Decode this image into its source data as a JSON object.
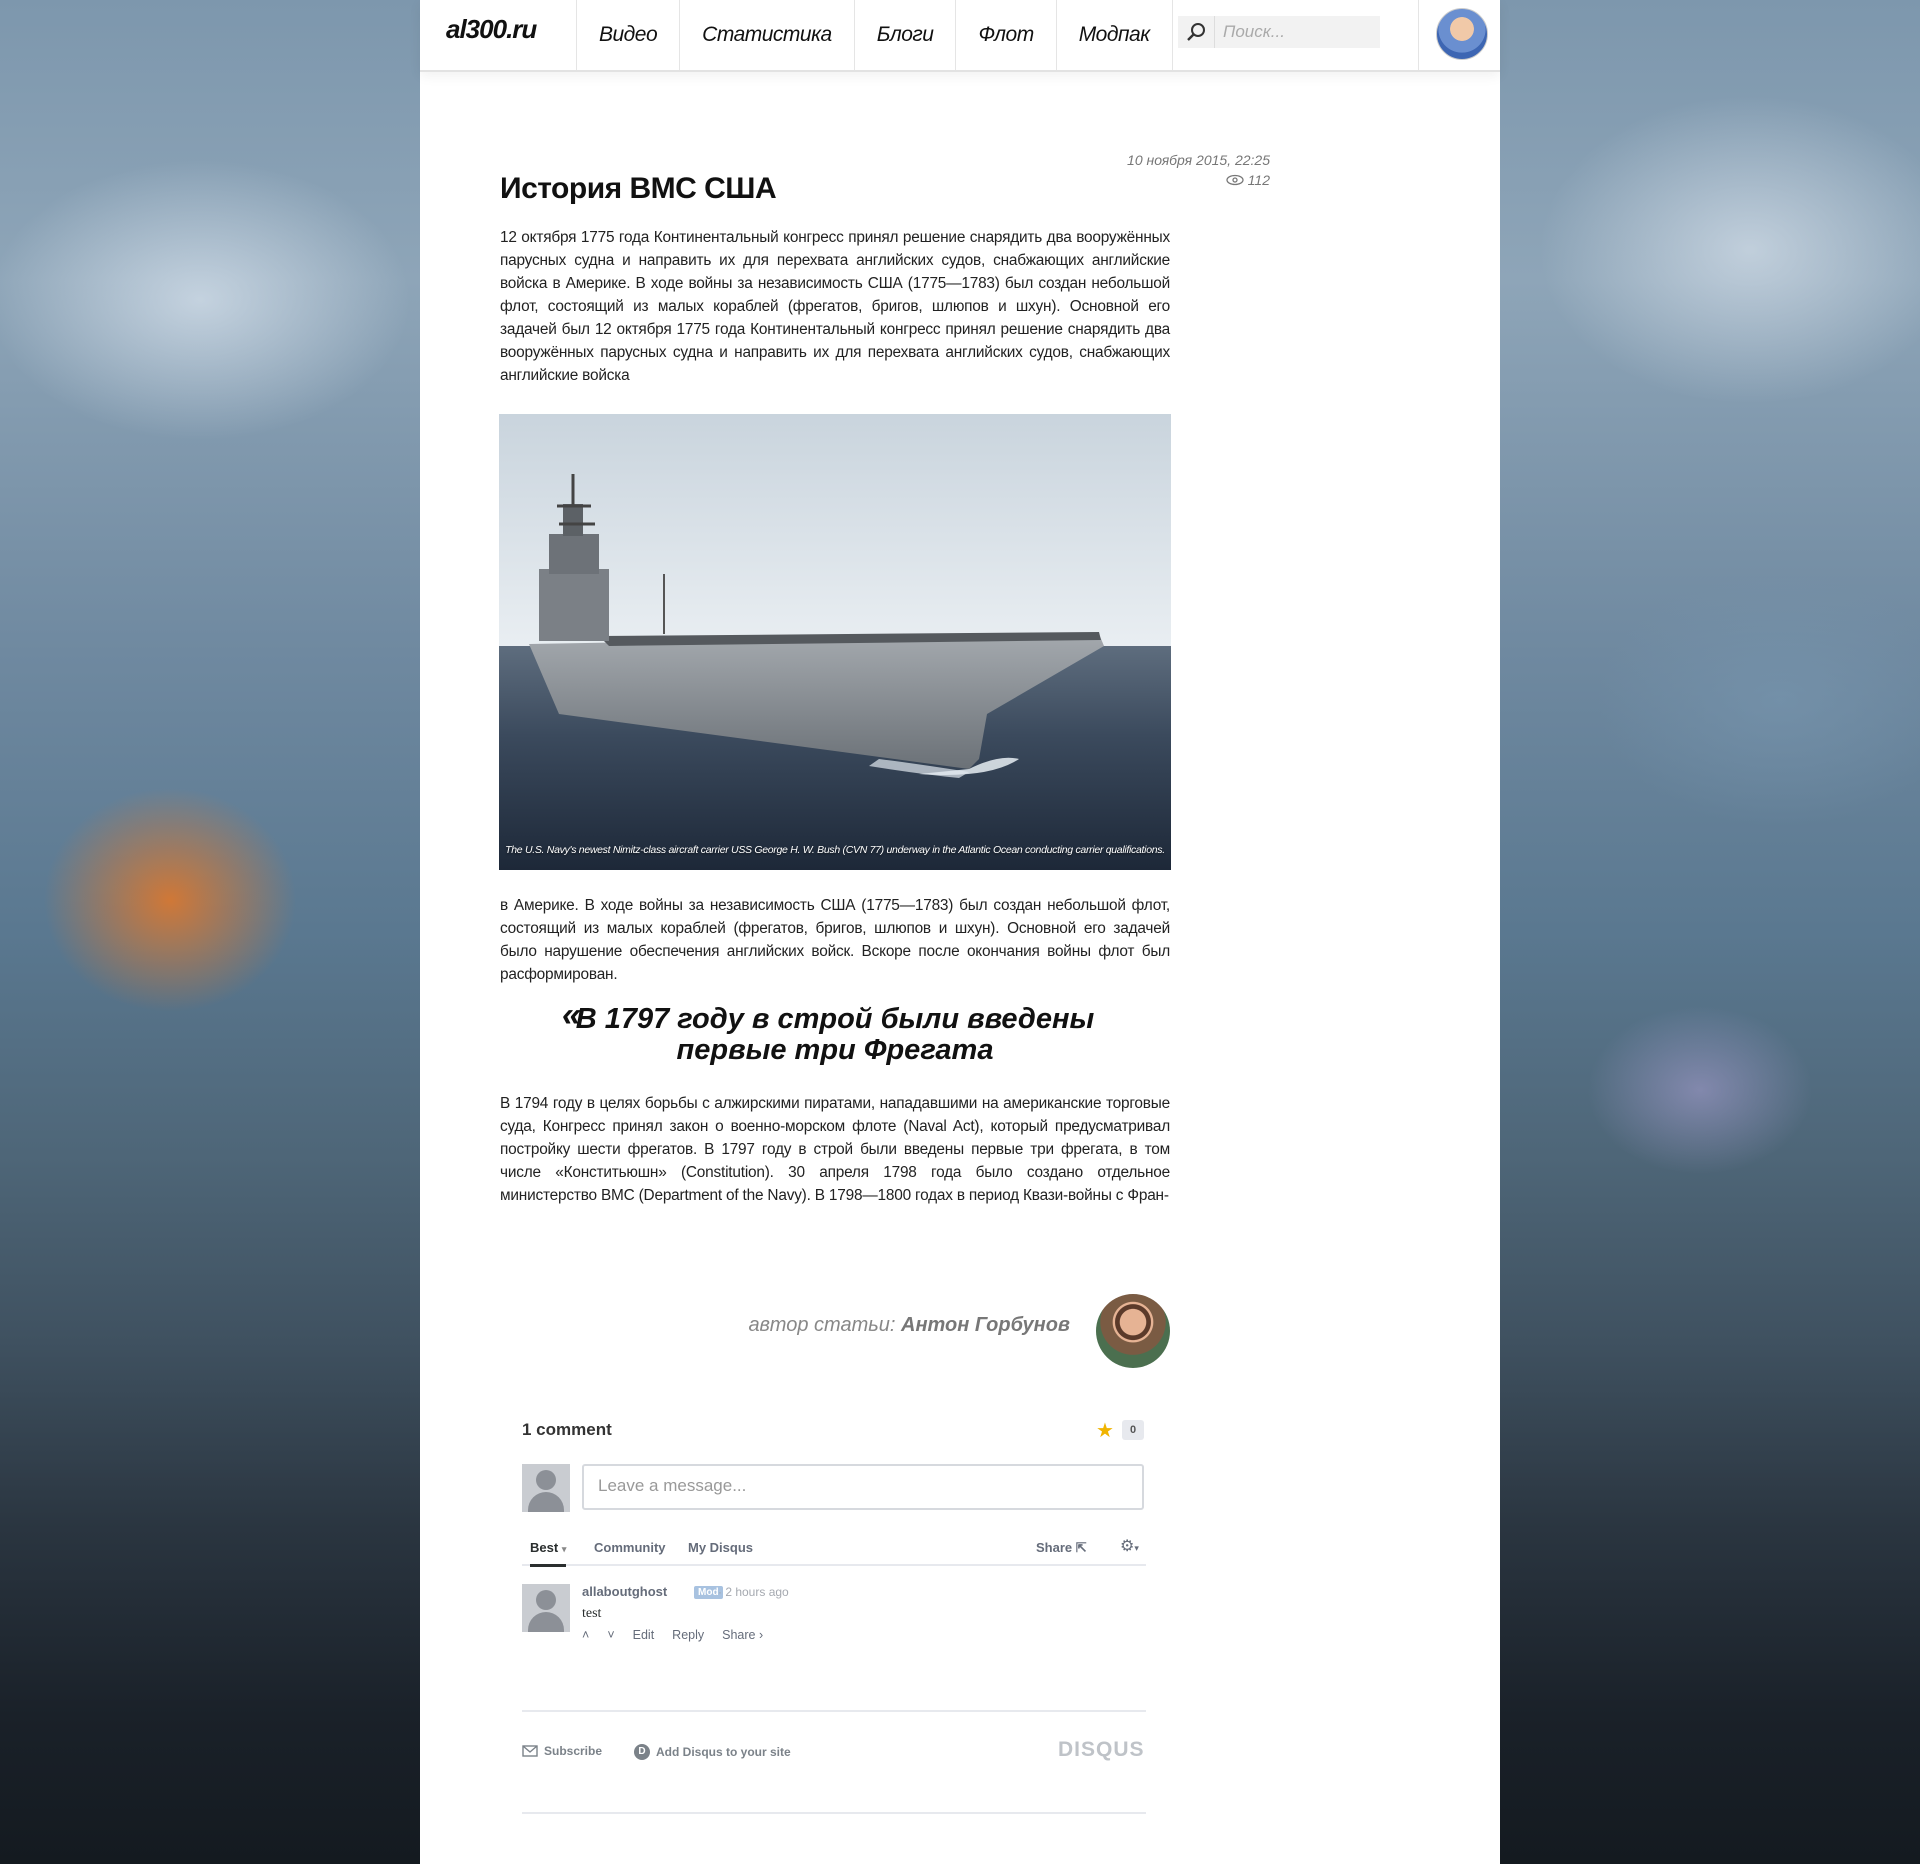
{
  "header": {
    "logo": "al300.ru",
    "nav": [
      "Видео",
      "Статистика",
      "Блоги",
      "Флот",
      "Модпак"
    ],
    "search_placeholder": "Поиск..."
  },
  "article": {
    "date": "10 ноября 2015, 22:25",
    "views": "112",
    "title": "История ВМС США",
    "paragraph1": "12 октября 1775 года Континентальный конгресс принял решение снарядить два вооружённых парусных судна и направить их для перехвата английских судов, снабжающих английские войска в Америке. В ходе войны за независимость США (1775—1783) был создан небольшой флот, состоящий из малых кораблей (фрегатов, бригов, шлюпов и шхун). Основной его задачей был 12 октября 1775 года Континентальный конгресс принял решение снарядить два вооружённых парусных судна и направить их для перехвата английских судов, снабжающих английские войска",
    "image_caption": "The U.S. Navy's newest Nimitz-class aircraft carrier USS George H. W. Bush (CVN 77) underway in the Atlantic Ocean conducting carrier qualifications.",
    "paragraph2": "в Америке. В ходе войны за независимость США (1775—1783) был создан небольшой флот, состоящий из малых кораблей (фрегатов, бригов, шлюпов и шхун). Основной его задачей было нарушение обеспечения английских войск. Вскоре после окончания войны флот был расформирован.",
    "quote_mark": "«",
    "quote": "В 1797 году в строй были введены первые три Фрегата",
    "paragraph3": "В 1794 году в целях борьбы с алжирскими пиратами, нападавшими на американские торговые суда, Конгресс принял закон о военно-морском флоте (Naval Act), который предусматривал постройку шести фрегатов. В 1797 году в строй были введены первые три фрегата, в том числе «Конститьюшн» (Constitution). 30 апреля 1798 года было создано отдельное министерство ВМС (Department of the Navy). В 1798—1800 годах в период Квази-войны с Фран-",
    "author_label": "автор статьи:",
    "author_name": "Антон Горбунов"
  },
  "disqus": {
    "count": "1 comment",
    "star_count": "0",
    "input_placeholder": "Leave a message...",
    "tabs": [
      "Best",
      "Community",
      "My Disqus"
    ],
    "share": "Share",
    "comment": {
      "author": "allaboutghost",
      "badge": "Mod",
      "time": "· 2 hours ago",
      "text": "test",
      "actions": [
        "Edit",
        "Reply",
        "Share ›"
      ]
    },
    "footer": {
      "subscribe": "Subscribe",
      "add": "Add Disqus to your site",
      "logo": "DISQUS"
    }
  },
  "colors": {
    "accent_star": "#f0b400",
    "mod_badge": "#a8c2e0"
  }
}
